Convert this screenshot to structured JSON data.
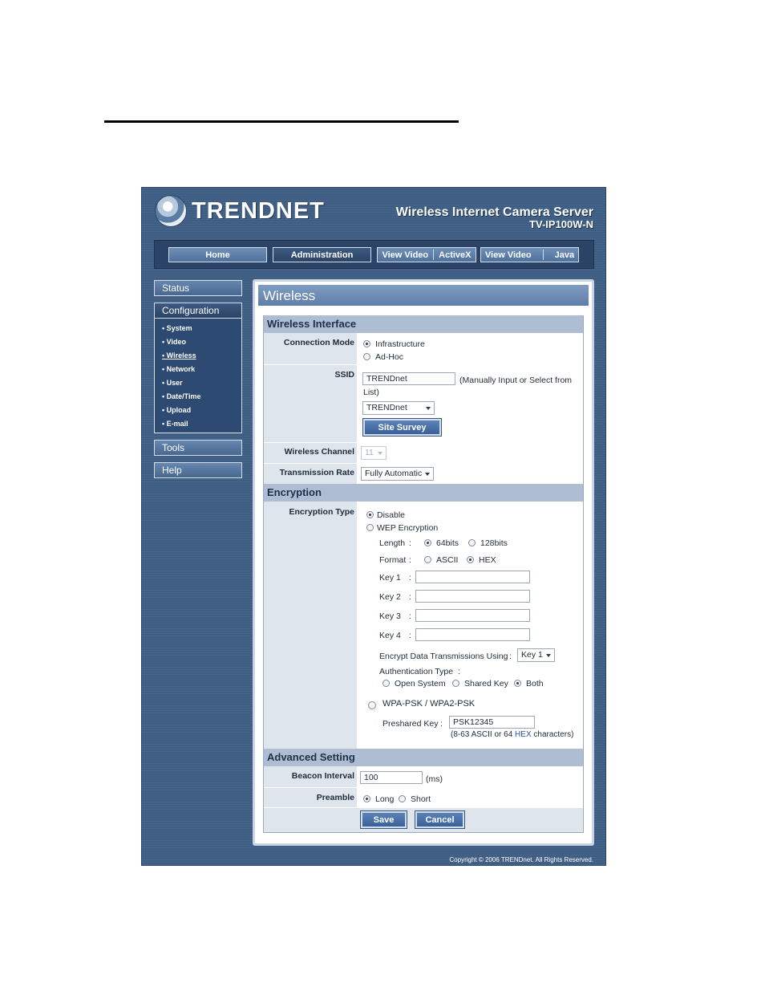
{
  "header": {
    "logo_text": "TRENDNET",
    "product_title": "Wireless Internet Camera Server",
    "product_model": "TV-IP100W-N"
  },
  "nav": {
    "home": "Home",
    "administration": "Administration",
    "view_video_1": "View Video",
    "activex": "ActiveX",
    "view_video_2": "View Video",
    "java": "Java"
  },
  "sidebar": {
    "status": "Status",
    "configuration": "Configuration",
    "items": [
      "System",
      "Video",
      "Wireless",
      "Network",
      "User",
      "Date/Time",
      "Upload",
      "E-mail"
    ],
    "tools": "Tools",
    "help": "Help"
  },
  "page_title": "Wireless",
  "wireless_interface": {
    "section": "Wireless Interface",
    "connection_mode_label": "Connection Mode",
    "infrastructure": "Infrastructure",
    "adhoc": "Ad-Hoc",
    "ssid_label": "SSID",
    "ssid_value": "TRENDnet",
    "ssid_hint_1": "(Manually Input or Select from",
    "ssid_hint_2": "List)",
    "ssid_select": "TRENDnet",
    "site_survey": "Site Survey",
    "channel_label": "Wireless Channel",
    "channel_value": "11",
    "rate_label": "Transmission Rate",
    "rate_value": "Fully Automatic"
  },
  "encryption": {
    "section": "Encryption",
    "type_label": "Encryption Type",
    "disable": "Disable",
    "wep": "WEP Encryption",
    "length_label": "Length",
    "colon": ":",
    "len_64": "64bits",
    "len_128": "128bits",
    "format_label": "Format",
    "fmt_ascii": "ASCII",
    "fmt_hex": "HEX",
    "key1": "Key 1",
    "key2": "Key 2",
    "key3": "Key 3",
    "key4": "Key 4",
    "encrypt_using_label": "Encrypt Data Transmissions Using",
    "encrypt_using_value": "Key 1",
    "auth_type_label": "Authentication Type",
    "open_system": "Open System",
    "shared_key": "Shared Key",
    "both": "Both",
    "wpa": "WPA-PSK / WPA2-PSK",
    "preshared_label": "Preshared Key",
    "preshared_value": "PSK12345",
    "preshared_hint_a": "(8-63 ASCII or 64 ",
    "preshared_hint_hex": "HEX",
    "preshared_hint_b": " characters)"
  },
  "advanced": {
    "section": "Advanced Setting",
    "beacon_label": "Beacon Interval",
    "beacon_value": "100",
    "beacon_unit": "(ms)",
    "preamble_label": "Preamble",
    "long": "Long",
    "short": "Short"
  },
  "buttons": {
    "save": "Save",
    "cancel": "Cancel"
  },
  "footer": {
    "copyright": "Copyright © 2006 TRENDnet. All Rights Reserved."
  },
  "colors": {
    "frame": "#3d5d83",
    "section_header": "#aebdd2",
    "label_column": "#dfe5ed",
    "hex_link": "#2b4fa8"
  }
}
